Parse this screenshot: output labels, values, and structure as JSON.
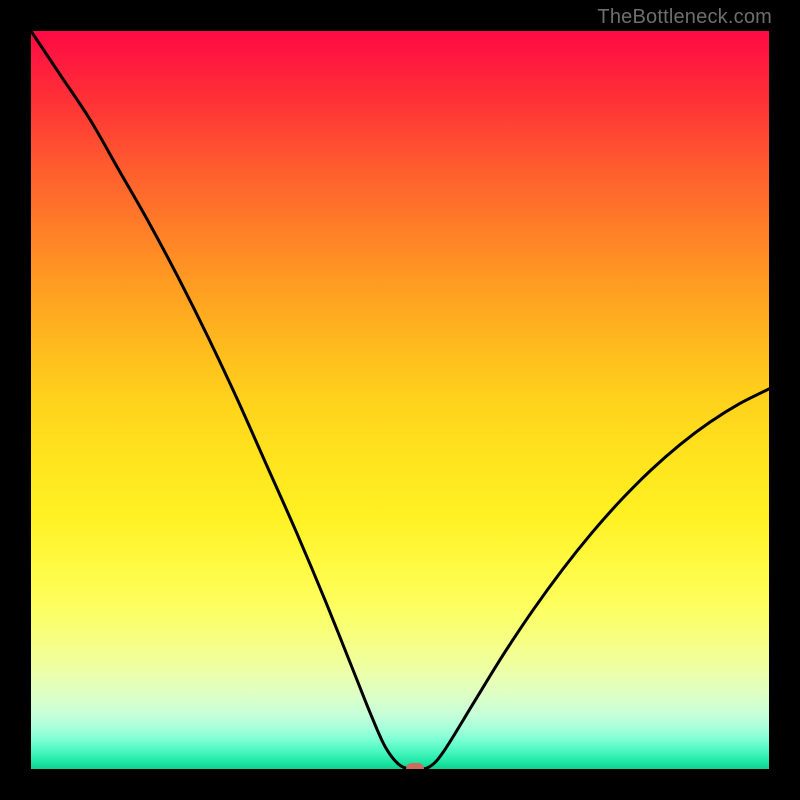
{
  "attribution": "TheBottleneck.com",
  "colors": {
    "curve_stroke": "#000000",
    "marker_fill": "#cf6a61",
    "plot_border": "#000000"
  },
  "chart_data": {
    "type": "line",
    "title": "",
    "xlabel": "",
    "ylabel": "",
    "xlim": [
      0,
      100
    ],
    "ylim": [
      0,
      100
    ],
    "x": [
      0,
      4,
      8,
      12,
      16,
      20,
      24,
      28,
      32,
      36,
      40,
      44,
      46,
      48,
      50,
      52,
      54,
      56,
      60,
      64,
      68,
      72,
      76,
      80,
      84,
      88,
      92,
      96,
      100
    ],
    "values": [
      100,
      94,
      88,
      81,
      74,
      66.5,
      58.5,
      50,
      41,
      32,
      22.5,
      12.5,
      7.5,
      3,
      0.5,
      0,
      0.3,
      2.5,
      9,
      15.5,
      21.5,
      27,
      32,
      36.5,
      40.5,
      44,
      47,
      49.5,
      51.5
    ],
    "marker": {
      "x": 52,
      "y": 0
    }
  }
}
